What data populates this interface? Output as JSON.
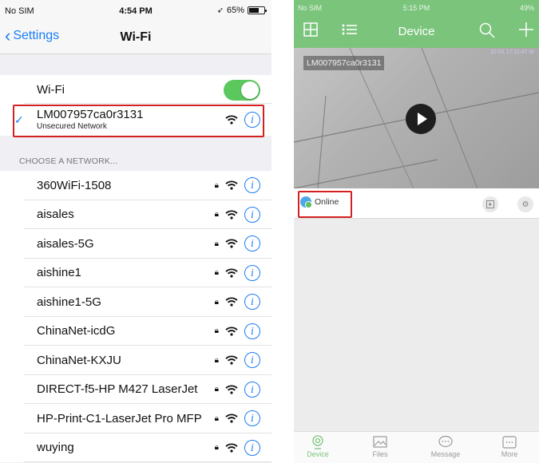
{
  "left": {
    "status": {
      "carrier": "No SIM",
      "time": "4:54 PM",
      "battery": "65%",
      "battery_level": 0.65
    },
    "nav": {
      "back_label": "Settings",
      "title": "Wi-Fi"
    },
    "wifi_toggle": {
      "label": "Wi-Fi",
      "on": true
    },
    "connected": {
      "ssid": "LM007957ca0r3131",
      "subtitle": "Unsecured Network"
    },
    "section_header": "CHOOSE A NETWORK...",
    "networks": [
      {
        "name": "360WiFi-1508"
      },
      {
        "name": "aisales"
      },
      {
        "name": "aisales-5G"
      },
      {
        "name": "aishine1"
      },
      {
        "name": "aishine1-5G"
      },
      {
        "name": "ChinaNet-icdG"
      },
      {
        "name": "ChinaNet-KXJU"
      },
      {
        "name": "DIRECT-f5-HP M427 LaserJet"
      },
      {
        "name": "HP-Print-C1-LaserJet Pro MFP"
      },
      {
        "name": "wuying"
      }
    ],
    "colors": {
      "accent": "#1a7cf5",
      "toggle_on": "#5bc85e",
      "highlight": "#d42020"
    }
  },
  "right": {
    "status": {
      "carrier": "No SIM",
      "time": "5:15 PM",
      "battery": "49%"
    },
    "header": {
      "title": "Device"
    },
    "camera": {
      "label": "LM007957ca0r3131",
      "timestamp": "11-01 17:11:47 W"
    },
    "device_status": "Online",
    "tabs": [
      {
        "label": "Device",
        "icon": "camera-icon"
      },
      {
        "label": "Files",
        "icon": "image-icon"
      },
      {
        "label": "Message",
        "icon": "message-icon"
      },
      {
        "label": "More",
        "icon": "more-icon"
      }
    ],
    "colors": {
      "header": "#7bc47c",
      "online": "#4da9e6"
    }
  }
}
